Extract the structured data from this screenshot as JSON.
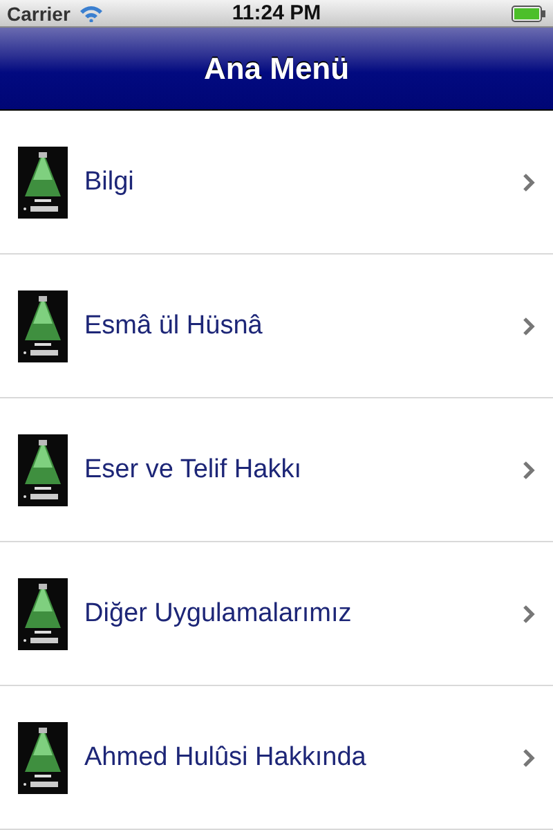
{
  "status_bar": {
    "carrier": "Carrier",
    "time": "11:24 PM"
  },
  "nav_bar": {
    "title": "Ana Menü"
  },
  "menu_items": [
    {
      "label": "Bilgi",
      "kind": "picture"
    },
    {
      "label": "Esmâ ül Hüsnâ",
      "kind": "picture"
    },
    {
      "label": "Eser ve Telif Hakkı",
      "kind": "picture"
    },
    {
      "label": "Diğer Uygulamalarımız",
      "kind": "picture"
    },
    {
      "label": "Ahmed Hulûsi Hakkında",
      "kind": "picture"
    }
  ]
}
